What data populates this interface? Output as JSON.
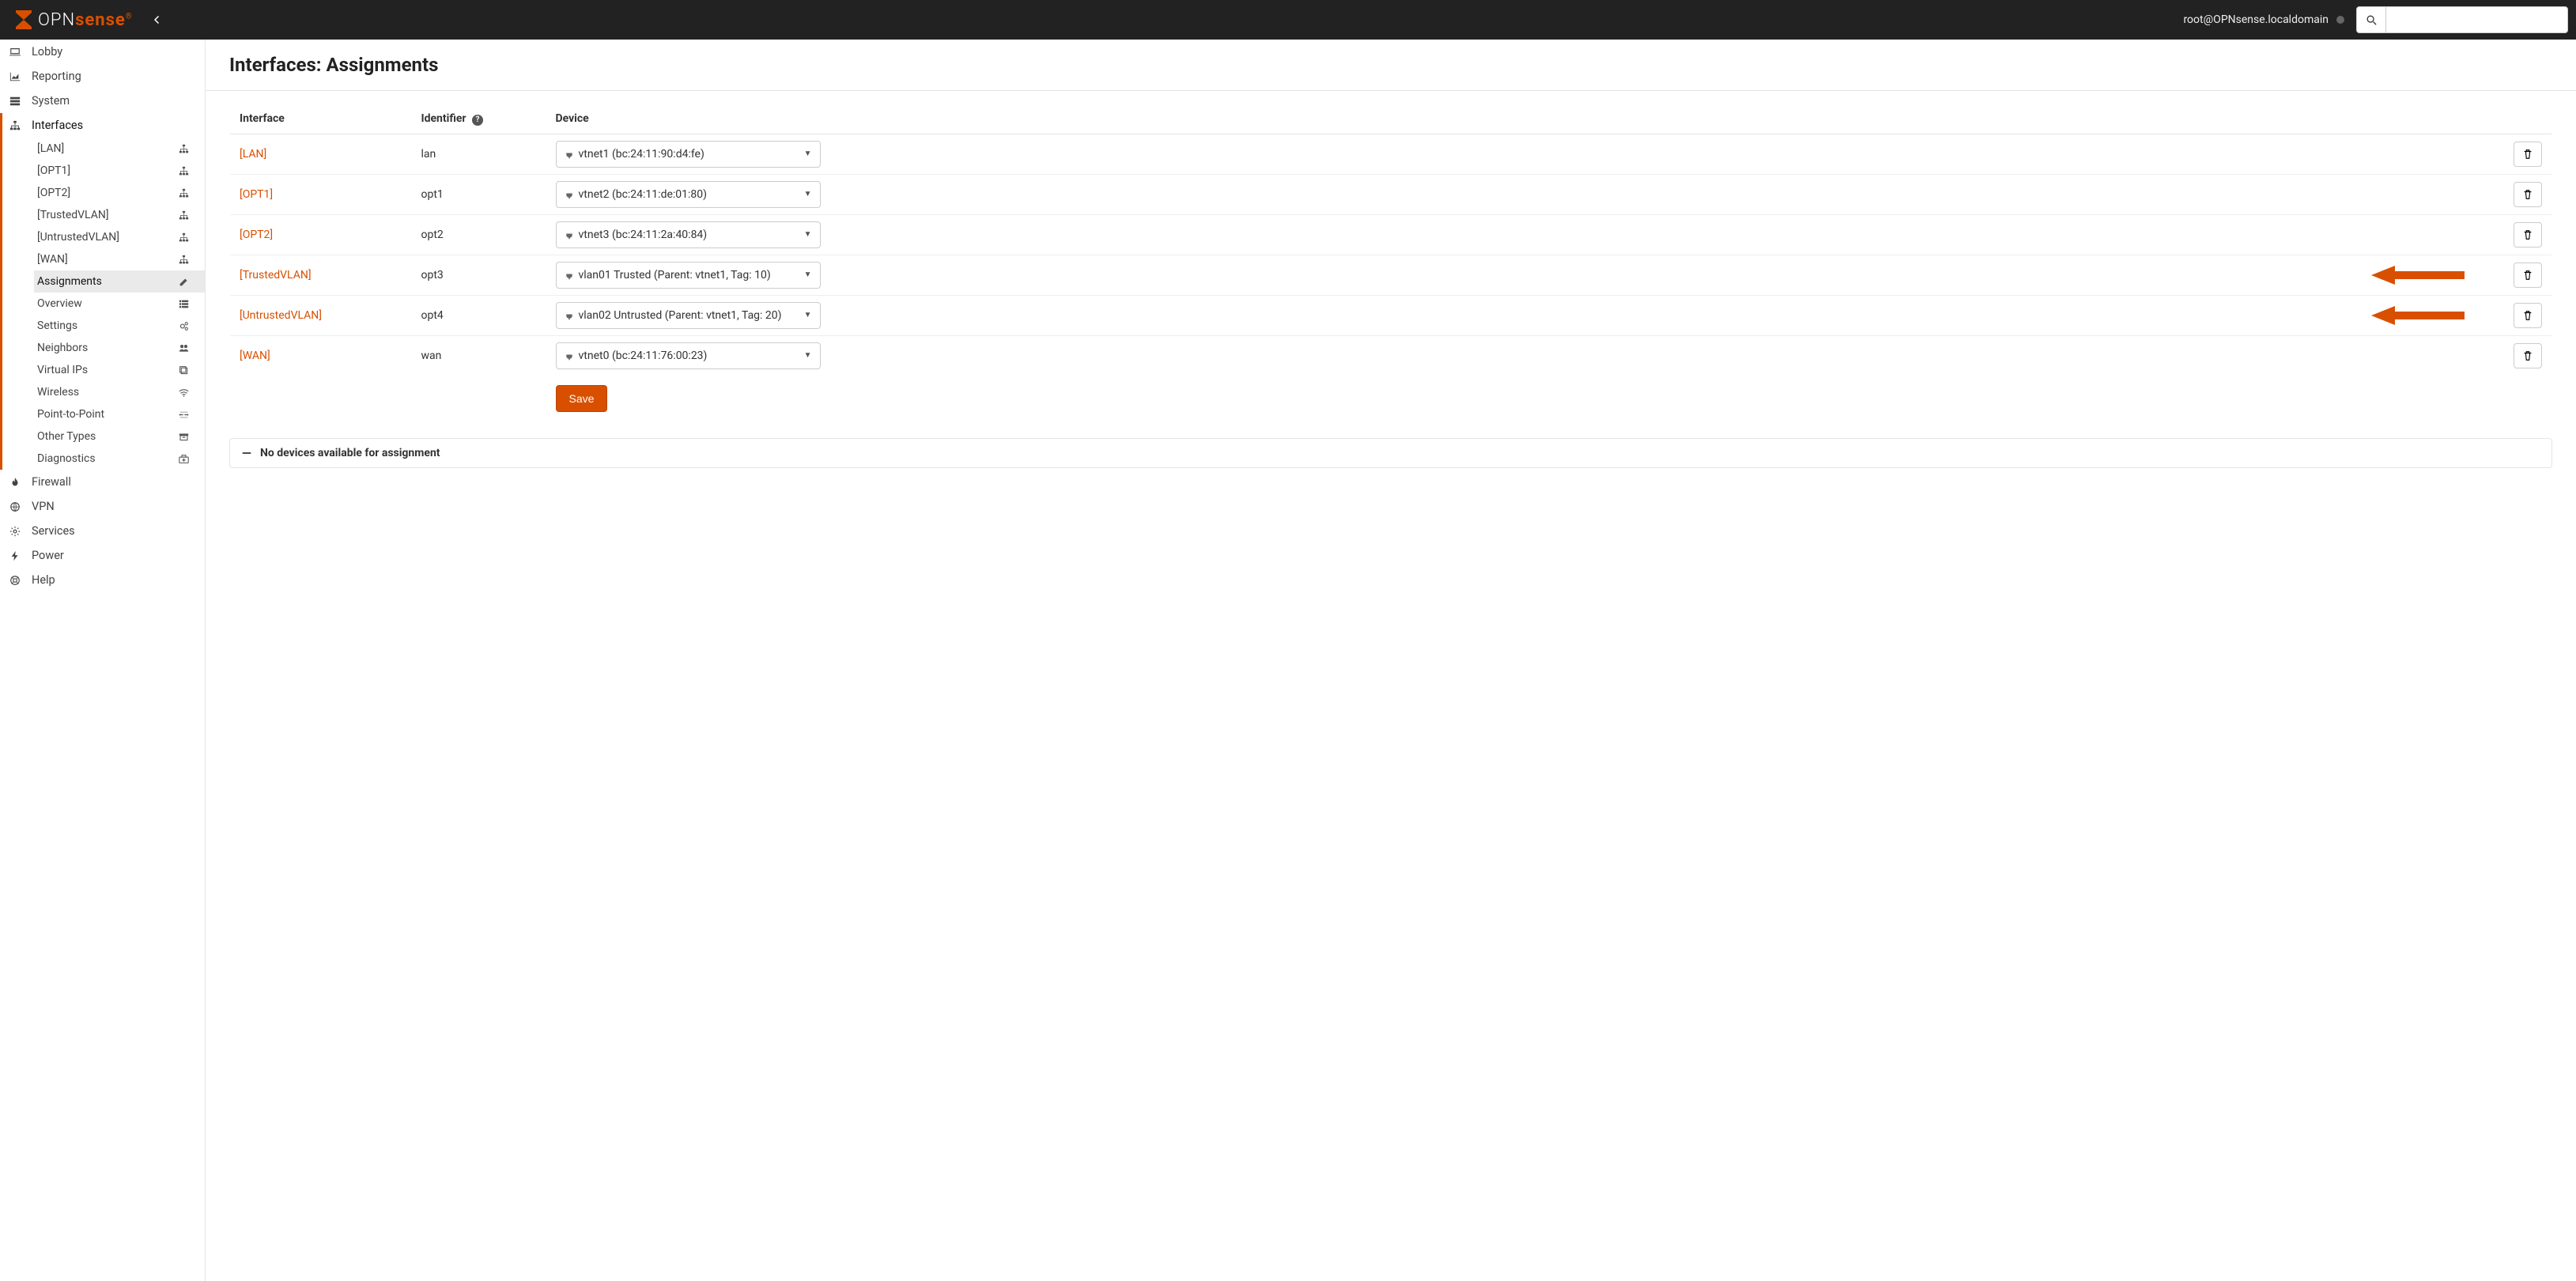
{
  "navbar": {
    "brand_opn": "OPN",
    "brand_sense": "sense",
    "user": "root@OPNsense.localdomain"
  },
  "sidebar": {
    "top": [
      {
        "label": "Lobby",
        "icon": "laptop"
      },
      {
        "label": "Reporting",
        "icon": "area-chart"
      },
      {
        "label": "System",
        "icon": "server"
      }
    ],
    "interfaces_label": "Interfaces",
    "interfaces_sub": [
      {
        "label": "[LAN]",
        "icon": "sitemap"
      },
      {
        "label": "[OPT1]",
        "icon": "sitemap"
      },
      {
        "label": "[OPT2]",
        "icon": "sitemap"
      },
      {
        "label": "[TrustedVLAN]",
        "icon": "sitemap"
      },
      {
        "label": "[UntrustedVLAN]",
        "icon": "sitemap"
      },
      {
        "label": "[WAN]",
        "icon": "sitemap"
      },
      {
        "label": "Assignments",
        "icon": "pencil",
        "active": true
      },
      {
        "label": "Overview",
        "icon": "th-list"
      },
      {
        "label": "Settings",
        "icon": "cogs"
      },
      {
        "label": "Neighbors",
        "icon": "users"
      },
      {
        "label": "Virtual IPs",
        "icon": "clone"
      },
      {
        "label": "Wireless",
        "icon": "wifi"
      },
      {
        "label": "Point-to-Point",
        "icon": "ppp"
      },
      {
        "label": "Other Types",
        "icon": "archive"
      },
      {
        "label": "Diagnostics",
        "icon": "medkit"
      }
    ],
    "bottom": [
      {
        "label": "Firewall",
        "icon": "fire"
      },
      {
        "label": "VPN",
        "icon": "globe"
      },
      {
        "label": "Services",
        "icon": "cog"
      },
      {
        "label": "Power",
        "icon": "bolt"
      },
      {
        "label": "Help",
        "icon": "life-ring"
      }
    ]
  },
  "page": {
    "title": "Interfaces: Assignments",
    "headers": {
      "interface": "Interface",
      "identifier": "Identifier",
      "device": "Device"
    },
    "rows": [
      {
        "interface": "[LAN]",
        "identifier": "lan",
        "device": "vtnet1 (bc:24:11:90:d4:fe)",
        "arrow": false
      },
      {
        "interface": "[OPT1]",
        "identifier": "opt1",
        "device": "vtnet2 (bc:24:11:de:01:80)",
        "arrow": false
      },
      {
        "interface": "[OPT2]",
        "identifier": "opt2",
        "device": "vtnet3 (bc:24:11:2a:40:84)",
        "arrow": false
      },
      {
        "interface": "[TrustedVLAN]",
        "identifier": "opt3",
        "device": "vlan01 Trusted (Parent: vtnet1, Tag: 10)",
        "arrow": true
      },
      {
        "interface": "[UntrustedVLAN]",
        "identifier": "opt4",
        "device": "vlan02 Untrusted (Parent: vtnet1, Tag: 20)",
        "arrow": true
      },
      {
        "interface": "[WAN]",
        "identifier": "wan",
        "device": "vtnet0 (bc:24:11:76:00:23)",
        "arrow": false
      }
    ],
    "save_label": "Save",
    "footer_text": "No devices available for assignment"
  }
}
